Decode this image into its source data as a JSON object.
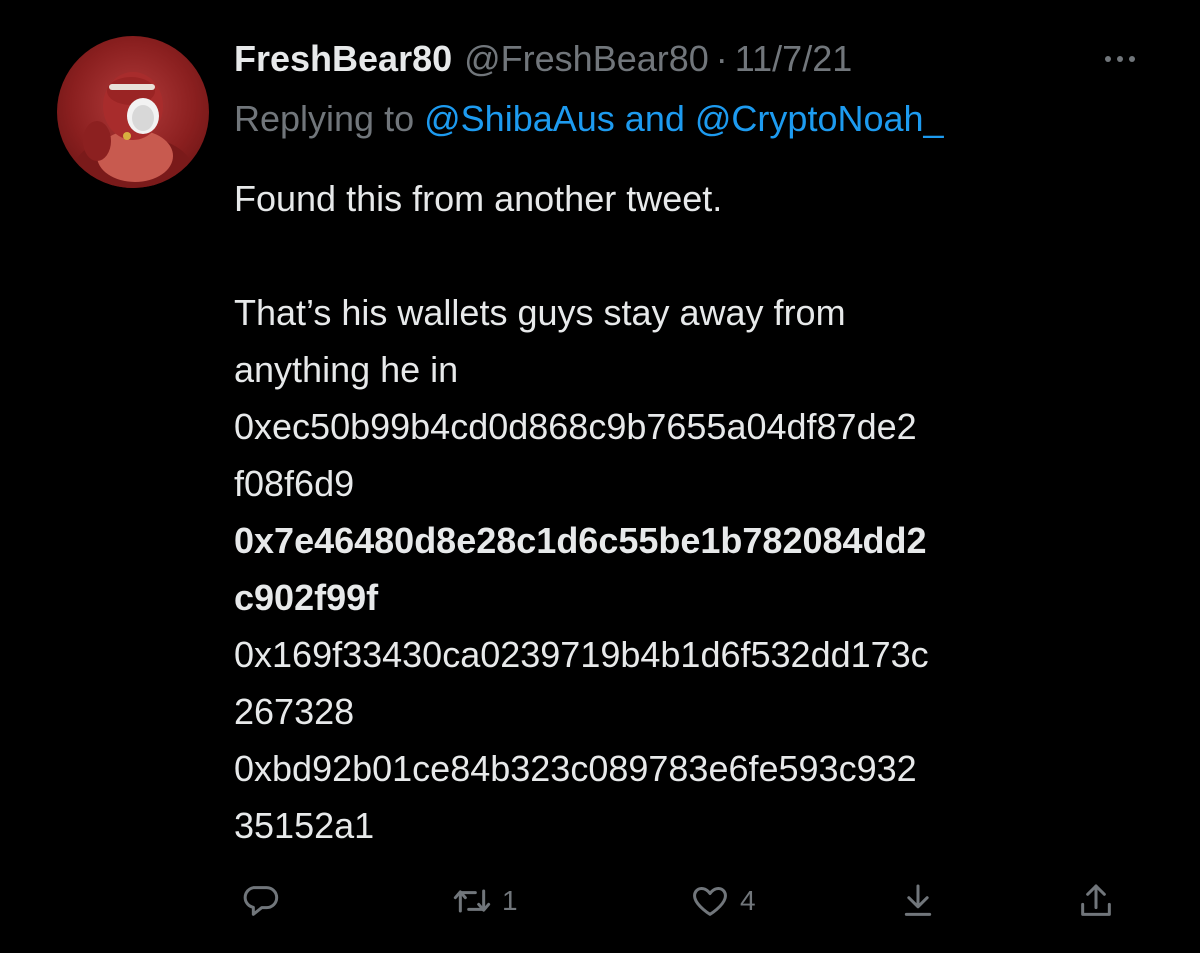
{
  "tweet": {
    "display_name": "FreshBear80",
    "handle": "@FreshBear80",
    "separator": "·",
    "date": "11/7/21",
    "replying_prefix": "Replying to",
    "reply_to_1": "@ShibaAus",
    "reply_joiner": "and",
    "reply_to_2": "@CryptoNoah_",
    "lines": [
      "Found this from another tweet.",
      "That’s his wallets guys stay away from",
      "anything he in",
      "0xec50b99b4cd0d868c9b7655a04df87de2",
      "f08f6d9",
      "0x7e46480d8e28c1d6c55be1b782084dd2",
      "c902f99f",
      "0x169f33430ca0239719b4b1d6f532dd173c",
      "267328",
      "0xbd92b01ce84b323c089783e6fe593c932",
      "35152a1"
    ]
  },
  "actions": {
    "reply": {
      "icon": "reply-icon"
    },
    "retweet": {
      "icon": "retweet-icon",
      "count": "1"
    },
    "like": {
      "icon": "heart-icon",
      "count": "4"
    },
    "save": {
      "icon": "download-icon"
    },
    "share": {
      "icon": "share-icon"
    }
  },
  "colors": {
    "background": "#000000",
    "text": "#e7e9ea",
    "muted": "#71767b",
    "link": "#1d9bf0"
  }
}
